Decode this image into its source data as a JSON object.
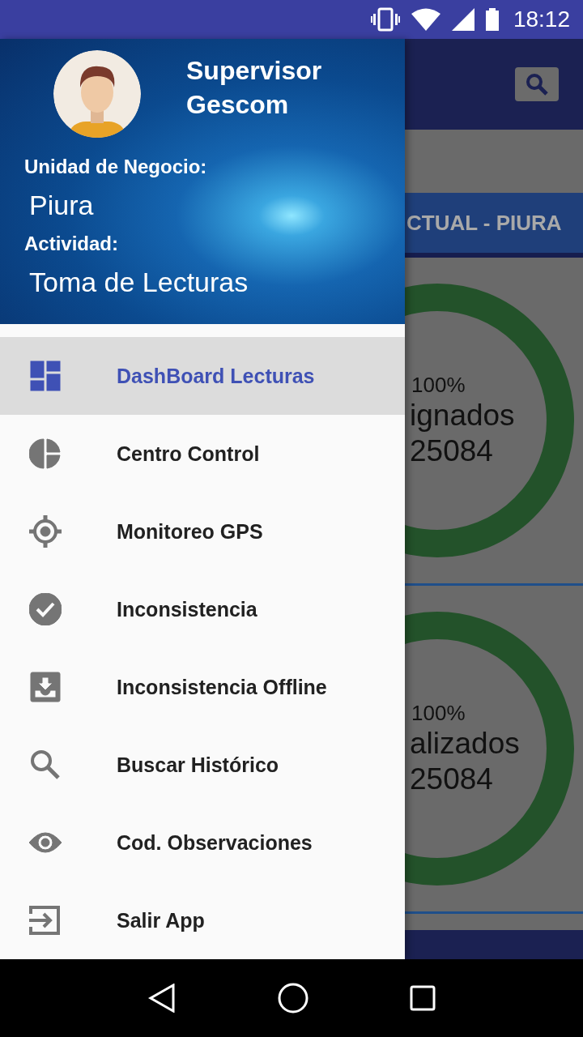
{
  "status_bar": {
    "time": "18:12"
  },
  "drawer": {
    "user_name": "Supervisor Gescom",
    "fields": [
      {
        "label": "Unidad de Negocio:",
        "value": "Piura"
      },
      {
        "label": "Actividad:",
        "value": "Toma de Lecturas"
      }
    ],
    "menu": [
      {
        "label": "DashBoard Lecturas",
        "kind": "dashboard",
        "selected": true
      },
      {
        "label": "Centro Control",
        "kind": "pie",
        "selected": false
      },
      {
        "label": "Monitoreo GPS",
        "kind": "gps",
        "selected": false
      },
      {
        "label": "Inconsistencia",
        "kind": "check",
        "selected": false
      },
      {
        "label": "Inconsistencia Offline",
        "kind": "download",
        "selected": false
      },
      {
        "label": "Buscar Histórico",
        "kind": "search",
        "selected": false
      },
      {
        "label": "Cod. Observaciones",
        "kind": "eye",
        "selected": false
      },
      {
        "label": "Salir App",
        "kind": "exit",
        "selected": false
      }
    ]
  },
  "background": {
    "tab_label": "CTUAL - PIURA",
    "cards": [
      {
        "percent": "100%",
        "label": "ignados",
        "count": "25084"
      },
      {
        "percent": "100%",
        "label": "alizados",
        "count": "25084"
      }
    ]
  }
}
